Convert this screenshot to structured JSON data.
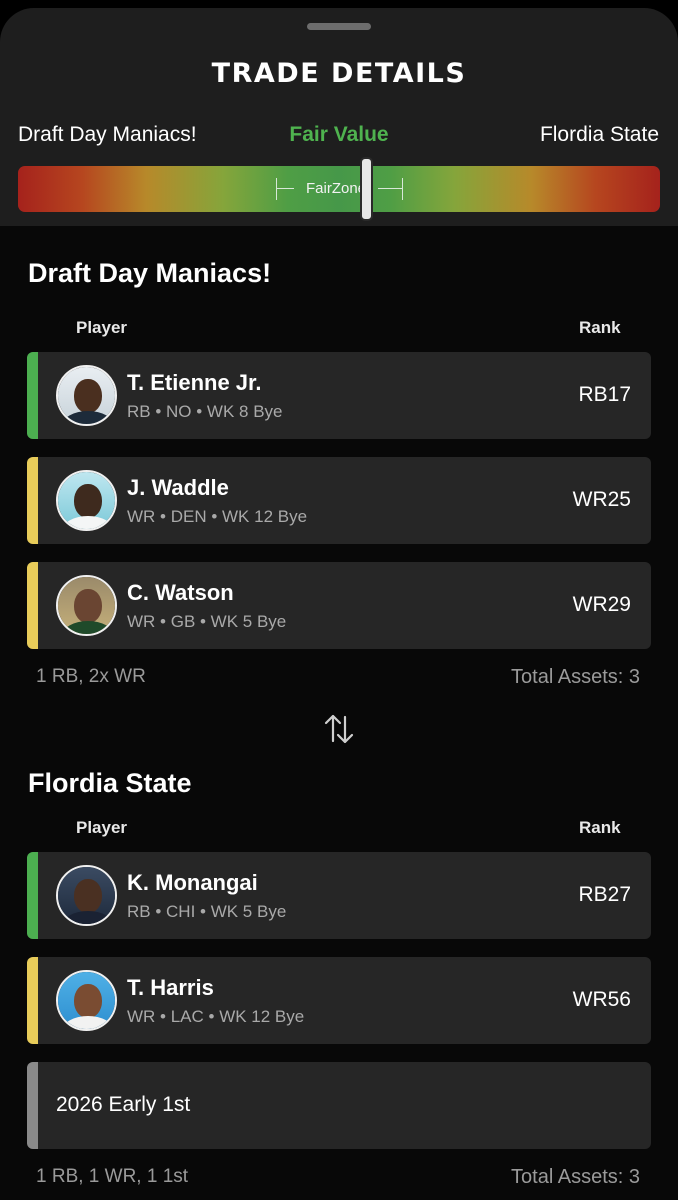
{
  "header": {
    "title": "TRADE DETAILS",
    "team_left": "Draft Day Maniacs!",
    "fair_value_label": "Fair Value",
    "team_right": "Flordia State",
    "fairzone_label": "FairZone"
  },
  "colors": {
    "tier_green": "#4caf50",
    "tier_yellow": "#e8cc5a",
    "tier_gray": "#8a8a8a",
    "fair_value_green": "#4fb34f"
  },
  "sides": [
    {
      "team": "Draft Day Maniacs!",
      "col_player": "Player",
      "col_rank": "Rank",
      "assets": [
        {
          "name": "T. Etienne Jr.",
          "meta": "RB • NO • WK 8 Bye",
          "rank": "RB17",
          "tier_color": "#4caf50",
          "avatar_icon": "player-photo-icon"
        },
        {
          "name": "J. Waddle",
          "meta": "WR • DEN • WK 12 Bye",
          "rank": "WR25",
          "tier_color": "#e8cc5a",
          "avatar_icon": "player-photo-icon"
        },
        {
          "name": "C. Watson",
          "meta": "WR • GB • WK 5 Bye",
          "rank": "WR29",
          "tier_color": "#e8cc5a",
          "avatar_icon": "player-photo-icon"
        }
      ],
      "summary": "1 RB,   2x WR",
      "total": "Total Assets:  3"
    },
    {
      "team": "Flordia State",
      "col_player": "Player",
      "col_rank": "Rank",
      "assets": [
        {
          "name": "K. Monangai",
          "meta": "RB • CHI • WK 5 Bye",
          "rank": "RB27",
          "tier_color": "#4caf50",
          "avatar_icon": "player-photo-icon"
        },
        {
          "name": "T. Harris",
          "meta": "WR • LAC • WK 12 Bye",
          "rank": "WR56",
          "tier_color": "#e8cc5a",
          "avatar_icon": "player-photo-icon"
        },
        {
          "label": "2026 Early 1st",
          "tier_color": "#8a8a8a"
        }
      ],
      "summary": "1 RB,   1 WR,   1 1st",
      "total": "Total Assets:  3"
    }
  ],
  "swap_icon": "swap-arrows-icon"
}
